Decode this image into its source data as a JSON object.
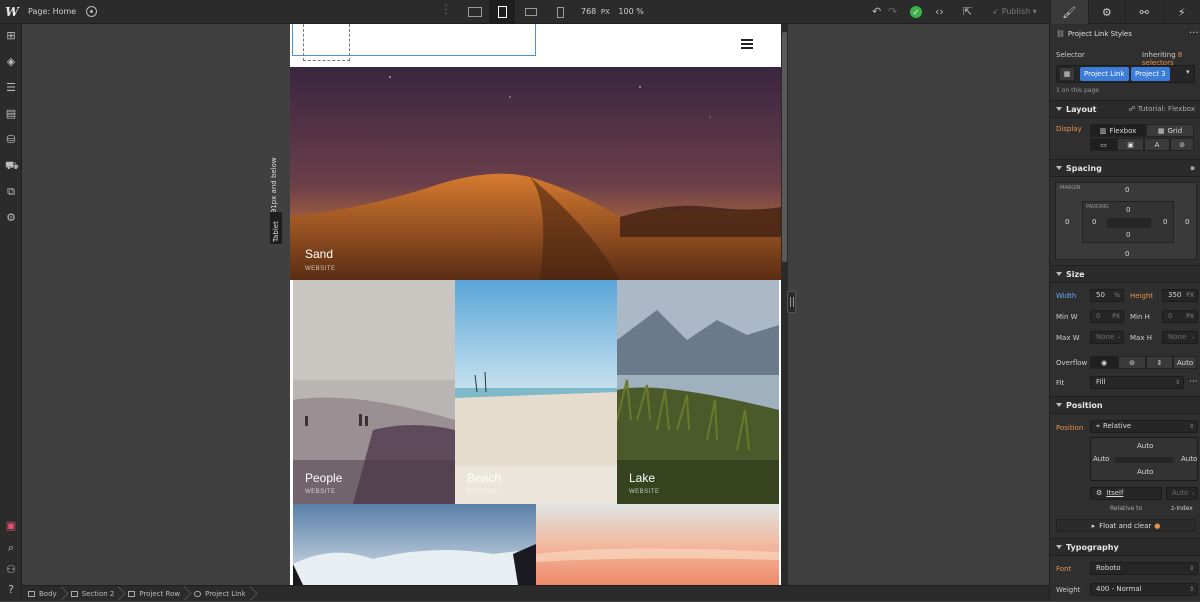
{
  "topbar": {
    "logo": "W",
    "page_label": "Page: Home",
    "width_px": "768",
    "width_unit": "PX",
    "zoom": "100 %",
    "publish_label": "Publish"
  },
  "canvas": {
    "breakpoint_label": "Affects 991px and below",
    "breakpoint_tag": "Tablet"
  },
  "site": {
    "hero": {
      "title": "Sand",
      "subtitle": "WEBSITE"
    },
    "tiles": [
      {
        "title": "People",
        "subtitle": "WEBSITE"
      },
      {
        "title": "Beach",
        "subtitle": "GRAPHIC"
      },
      {
        "title": "Lake",
        "subtitle": "WEBSITE"
      }
    ]
  },
  "breadcrumbs": [
    "Body",
    "Section 2",
    "Project Row",
    "Project Link"
  ],
  "panel": {
    "header": "Project Link Styles",
    "selector_label": "Selector",
    "inheriting_prefix": "Inheriting",
    "inheriting_count": "8 selectors",
    "selector_tags": [
      "Project Link",
      "Project 3"
    ],
    "on_page": "1 on this page",
    "layout": {
      "title": "Layout",
      "tutorial": "Tutorial: Flexbox",
      "display_label": "Display",
      "flexbox": "Flexbox",
      "grid": "Grid"
    },
    "spacing": {
      "title": "Spacing",
      "margin_label": "MARGIN",
      "padding_label": "PADDING",
      "margin": {
        "top": "0",
        "right": "0",
        "bottom": "0",
        "left": "0"
      },
      "padding": {
        "top": "0",
        "right": "0",
        "bottom": "0",
        "left": "0"
      }
    },
    "size": {
      "title": "Size",
      "width_label": "Width",
      "width_value": "50",
      "width_unit": "%",
      "height_label": "Height",
      "height_value": "350",
      "height_unit": "PX",
      "minw_label": "Min W",
      "minw_value": "0",
      "minw_unit": "PX",
      "minh_label": "Min H",
      "minh_value": "0",
      "minh_unit": "PX",
      "maxw_label": "Max W",
      "maxw_value": "None",
      "maxh_label": "Max H",
      "maxh_value": "None",
      "overflow_label": "Overflow",
      "overflow_auto": "Auto",
      "fit_label": "Fit",
      "fit_value": "Fill"
    },
    "position": {
      "title": "Position",
      "position_label": "Position",
      "position_value": "Relative",
      "top": "Auto",
      "left": "Auto",
      "right": "Auto",
      "bottom": "Auto",
      "itself": "Itself",
      "zindex_value": "Auto",
      "relative_to": "Relative to",
      "zindex_label": "z-Index",
      "float_clear": "Float and clear"
    },
    "typography": {
      "title": "Typography",
      "font_label": "Font",
      "font_value": "Roboto",
      "weight_label": "Weight",
      "weight_value": "400 - Normal"
    }
  },
  "colors": {
    "accent_blue": "#3b7dd8",
    "accent_orange": "#e8924a",
    "success_green": "#3cb34a",
    "panel_bg": "#2f2f2f"
  }
}
